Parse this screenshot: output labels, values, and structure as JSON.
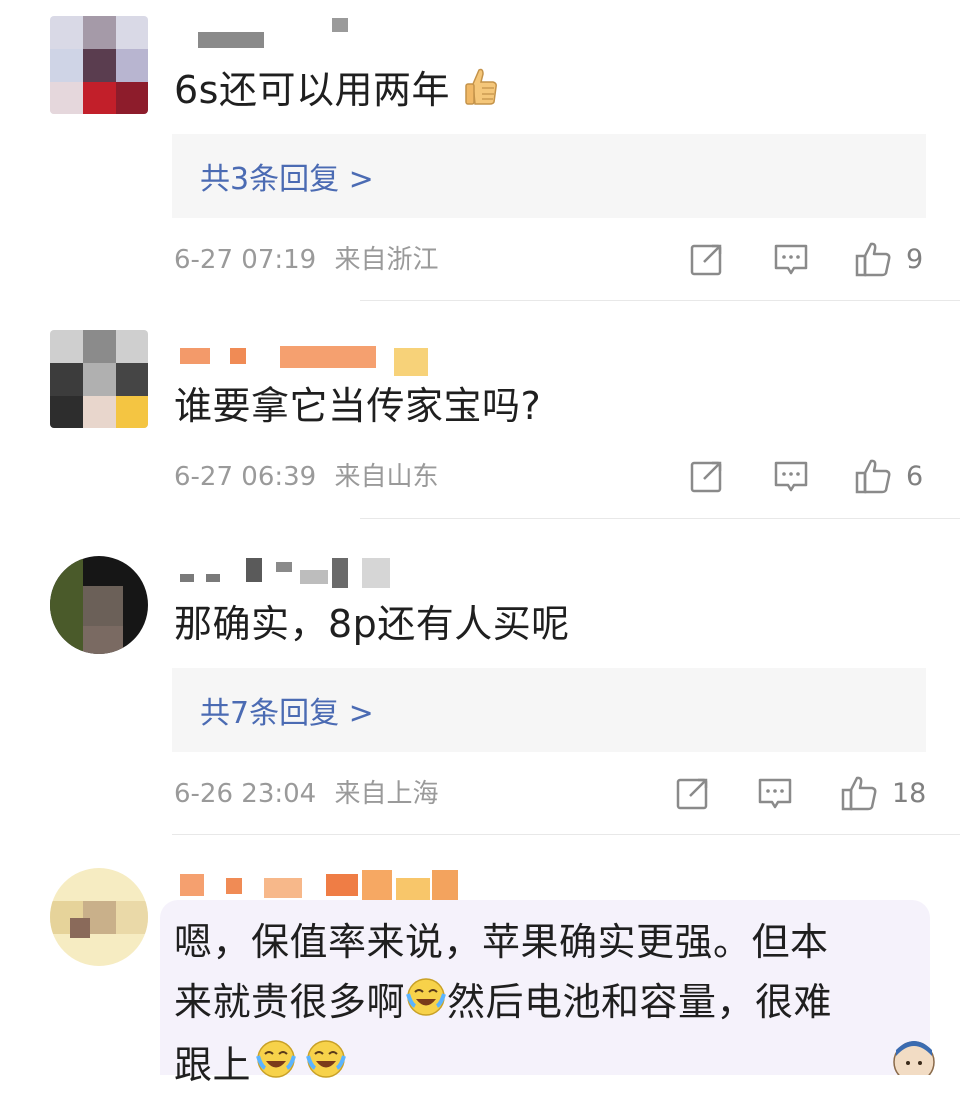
{
  "comments": [
    {
      "text": "6s还可以用两年",
      "emoji": "thumbs-up-icon",
      "reply_label": "共3条回复 >",
      "time": "6-27 07:19",
      "location": "来自浙江",
      "likes": "9"
    },
    {
      "text": "谁要拿它当传家宝吗?",
      "time": "6-27 06:39",
      "location": "来自山东",
      "likes": "6"
    },
    {
      "text": "那确实，8p还有人买呢",
      "reply_label": "共7条回复 >",
      "time": "6-26 23:04",
      "location": "来自上海",
      "likes": "18"
    },
    {
      "text_line1": "嗯，保值率来说，苹果确实更强。但本",
      "text_line2a": "来就贵很多啊",
      "text_line2b": "然后电池和容量，很难",
      "text_line3": "跟上",
      "emoji": "laughing-tears-icon"
    }
  ],
  "colors": {
    "link": "#4b6bb3",
    "meta": "#9a9a9a",
    "reply_bg": "#f6f6f6",
    "icon": "#8a8a8a"
  }
}
